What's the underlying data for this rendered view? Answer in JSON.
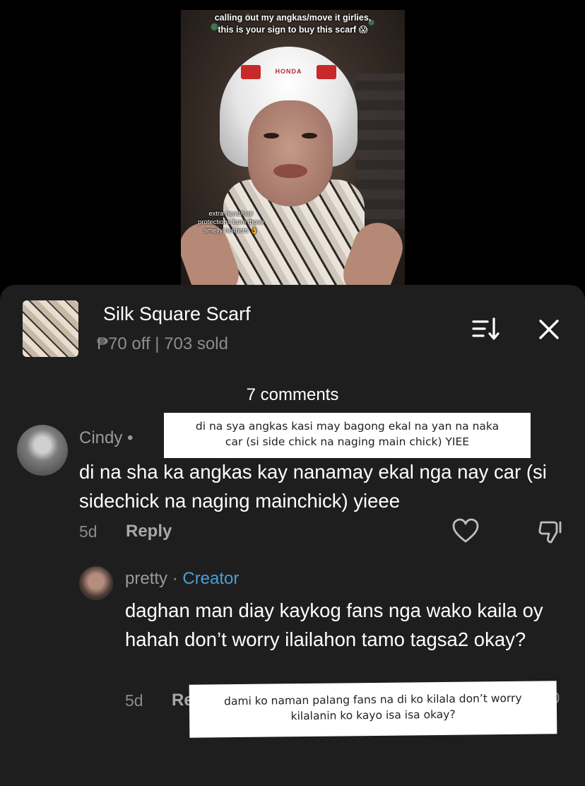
{
  "video": {
    "caption_line1": "calling out my angkas/move it girlies,",
    "caption_line2": "this is your sign to buy this scarf 😱",
    "overlay_line1": "extra head/hair",
    "overlay_line2": "protections from those",
    "overlay_line3": "smelly helmets 👌",
    "helmet_brand": "HONDA"
  },
  "product": {
    "title": "Silk Square Scarf",
    "subtitle": "₱70 off | 703 sold"
  },
  "comments_header": "7 comments",
  "comment1": {
    "name": "Cindy •",
    "text": "di na sha ka angkas kay nanamay ekal nga nay car (si sidechick na naging mainchick) yieee",
    "date": "5d",
    "reply": "Reply"
  },
  "comment2": {
    "name": "pretty · ",
    "badge": "Creator",
    "text": "daghan man diay kaykog fans nga wako kaila oy hahah don’t worry ilailahon tamo tagsa2 okay?",
    "date": "5d",
    "reply": "Re",
    "tail": "0"
  },
  "translation1": {
    "line1": "di na sya angkas kasi may bagong ekal na yan na naka",
    "line2": "car (si side chick na naging main chick) YIEE"
  },
  "translation2": {
    "line1": "dami ko naman palang fans na di ko kilala don’t worry",
    "line2": "kilalanin ko kayo isa isa okay?"
  },
  "colors": {
    "sheet_bg": "#1e1e1e",
    "creator_accent": "#4a9fd8"
  }
}
